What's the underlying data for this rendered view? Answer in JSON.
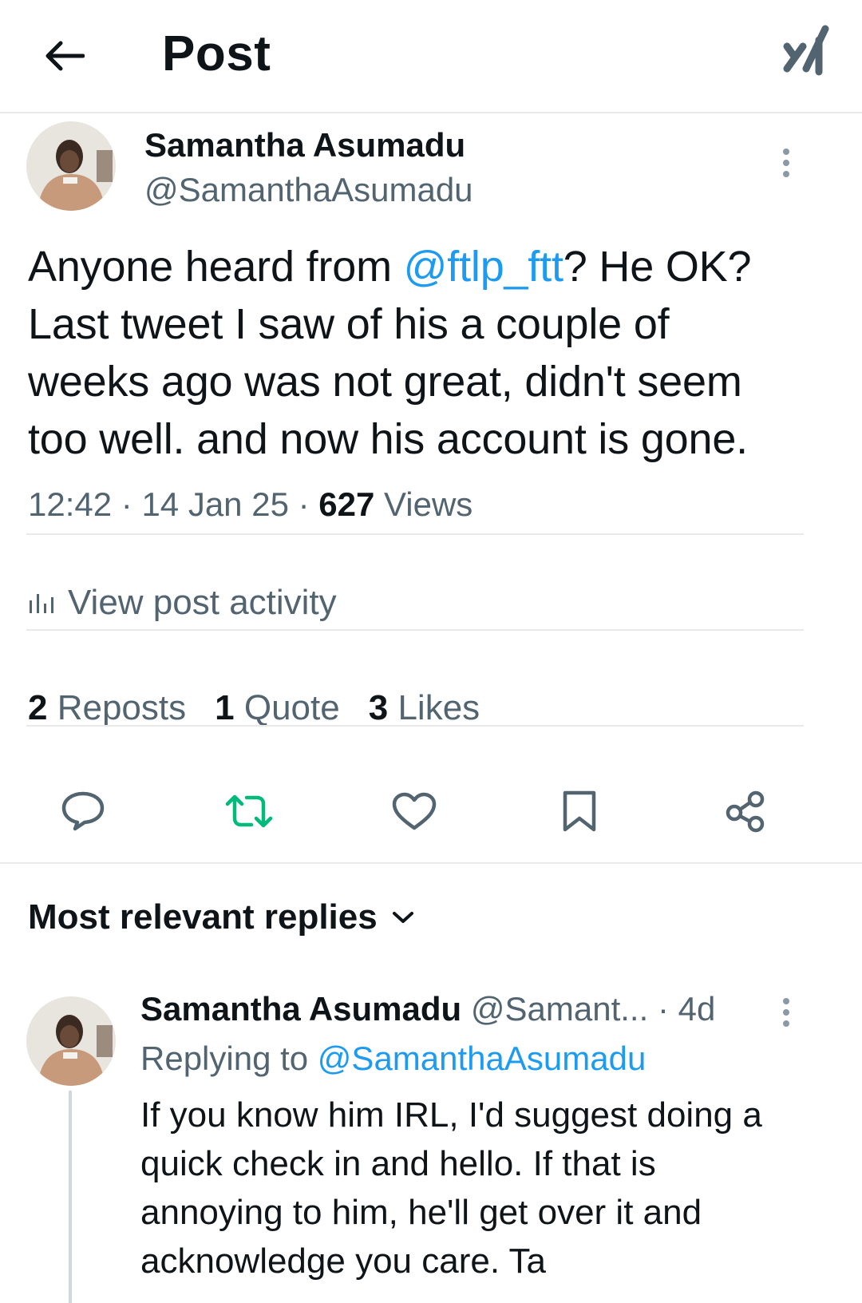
{
  "header": {
    "title": "Post",
    "back_icon": "arrow-left-icon",
    "grok_icon": "grok-icon"
  },
  "post": {
    "author_name": "Samantha Asumadu",
    "author_handle": "@SamanthaAsumadu",
    "text_line1_a": "Anyone heard from ",
    "mention": "@ftlp_ftt",
    "text_line1_b": "? He OK?",
    "text_line2": "Last tweet I saw of his a couple of",
    "text_line3": "weeks ago was not great, didn't seem",
    "text_line4": "too well. and now his account is gone.",
    "time": "12:42",
    "date": "14 Jan 25",
    "views_count": "627",
    "views_label": "Views",
    "activity_label": "View post activity",
    "stats": {
      "reposts_count": "2",
      "reposts_label": "Reposts",
      "quotes_count": "1",
      "quotes_label": "Quote",
      "likes_count": "3",
      "likes_label": "Likes"
    },
    "accent_color": "#1d9bf0",
    "repost_color": "#00ba7c"
  },
  "replies": {
    "header_label": "Most relevant replies",
    "items": [
      {
        "author_name": "Samantha Asumadu",
        "handle": "@Samant...",
        "time": "· 4d",
        "replying_prefix": "Replying to ",
        "replying_to": "@SamanthaAsumadu",
        "line1": "If you know him IRL, I'd suggest doing a",
        "line2": "quick check in and hello. If that is",
        "line3": "annoying to him, he'll get over it and",
        "line4": "acknowledge you care. Ta"
      }
    ]
  }
}
